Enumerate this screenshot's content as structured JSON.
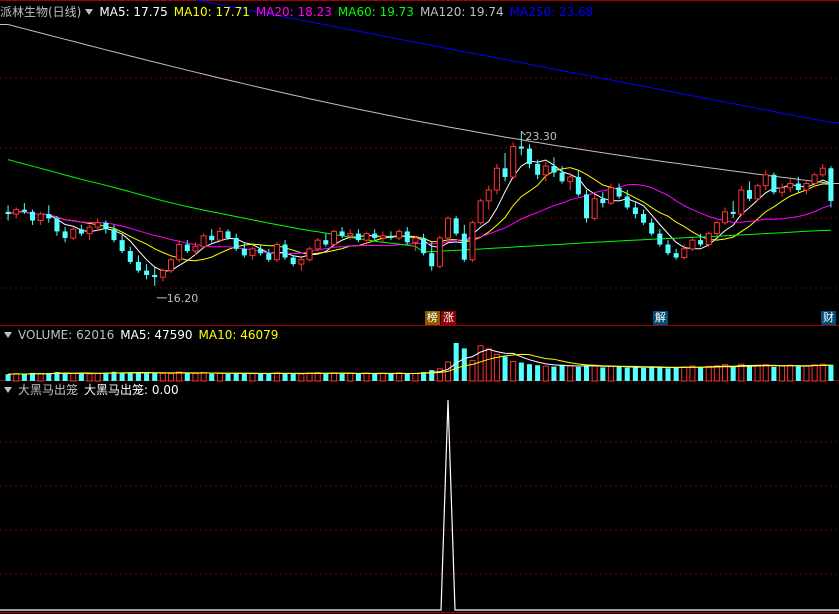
{
  "header": {
    "stock_name": "派林生物(日线)",
    "ma": [
      {
        "label": "MA5: 17.75",
        "color": "#ffffff"
      },
      {
        "label": "MA10: 17.71",
        "color": "#ffff00"
      },
      {
        "label": "MA20: 18.23",
        "color": "#ff00ff"
      },
      {
        "label": "MA60: 19.73",
        "color": "#00ff00"
      },
      {
        "label": "MA120: 19.74",
        "color": "#c0c0c0"
      },
      {
        "label": "MA250: 23.68",
        "color": "#0000ff"
      }
    ]
  },
  "volume_header": {
    "volume": "VOLUME: 62016",
    "ma5": "MA5: 47590",
    "ma10": "MA10: 46079"
  },
  "indicator_header": {
    "name": "大黑马出笼",
    "series": "大黑马出笼: 0.00"
  },
  "annotations": {
    "high": "23.30",
    "low": "16.20",
    "tags": [
      {
        "text": "榜",
        "bg": "#8b5a00"
      },
      {
        "text": "涨",
        "bg": "#8b0000"
      },
      {
        "text": "解",
        "bg": "#004f7a"
      },
      {
        "text": "财",
        "bg": "#004f7a"
      }
    ]
  },
  "chart_data": {
    "type": "candlestick",
    "price_range": [
      15.0,
      28.5
    ],
    "candles": [
      [
        19.6,
        19.9,
        19.2,
        19.5
      ],
      [
        19.5,
        19.8,
        19.3,
        19.7
      ],
      [
        19.7,
        20.0,
        19.5,
        19.6
      ],
      [
        19.6,
        19.7,
        19.0,
        19.2
      ],
      [
        19.2,
        19.6,
        19.0,
        19.5
      ],
      [
        19.5,
        19.9,
        19.1,
        19.3
      ],
      [
        19.3,
        19.4,
        18.5,
        18.7
      ],
      [
        18.7,
        18.9,
        18.2,
        18.4
      ],
      [
        18.4,
        18.9,
        18.3,
        18.8
      ],
      [
        18.8,
        19.0,
        18.5,
        18.6
      ],
      [
        18.6,
        19.0,
        18.3,
        18.9
      ],
      [
        18.9,
        19.3,
        18.7,
        19.1
      ],
      [
        19.1,
        19.2,
        18.6,
        18.8
      ],
      [
        18.8,
        19.0,
        18.2,
        18.3
      ],
      [
        18.3,
        18.6,
        17.7,
        17.8
      ],
      [
        17.8,
        18.0,
        17.2,
        17.3
      ],
      [
        17.3,
        17.6,
        16.8,
        16.9
      ],
      [
        16.9,
        17.2,
        16.5,
        16.7
      ],
      [
        16.7,
        17.1,
        16.2,
        16.6
      ],
      [
        16.6,
        17.0,
        16.4,
        16.9
      ],
      [
        16.9,
        17.5,
        16.8,
        17.4
      ],
      [
        17.4,
        18.3,
        17.3,
        18.1
      ],
      [
        18.1,
        18.3,
        17.7,
        17.8
      ],
      [
        17.8,
        18.2,
        17.6,
        18.0
      ],
      [
        18.0,
        18.6,
        17.9,
        18.5
      ],
      [
        18.5,
        18.8,
        18.2,
        18.3
      ],
      [
        18.3,
        18.9,
        18.2,
        18.7
      ],
      [
        18.7,
        18.8,
        18.3,
        18.4
      ],
      [
        18.4,
        18.6,
        17.8,
        17.9
      ],
      [
        17.9,
        18.2,
        17.5,
        17.6
      ],
      [
        17.6,
        18.0,
        17.4,
        17.9
      ],
      [
        17.9,
        18.1,
        17.6,
        17.7
      ],
      [
        17.7,
        17.9,
        17.3,
        17.4
      ],
      [
        17.4,
        18.2,
        17.3,
        18.1
      ],
      [
        18.1,
        18.3,
        17.4,
        17.5
      ],
      [
        17.5,
        17.6,
        17.1,
        17.2
      ],
      [
        17.2,
        17.5,
        16.9,
        17.4
      ],
      [
        17.4,
        18.0,
        17.3,
        17.9
      ],
      [
        17.9,
        18.4,
        17.8,
        18.3
      ],
      [
        18.3,
        18.6,
        18.0,
        18.1
      ],
      [
        18.1,
        18.8,
        18.0,
        18.7
      ],
      [
        18.7,
        18.9,
        18.4,
        18.5
      ],
      [
        18.5,
        18.8,
        18.3,
        18.6
      ],
      [
        18.6,
        18.8,
        18.2,
        18.3
      ],
      [
        18.3,
        18.7,
        18.1,
        18.6
      ],
      [
        18.6,
        18.8,
        18.3,
        18.4
      ],
      [
        18.4,
        18.7,
        18.2,
        18.5
      ],
      [
        18.5,
        18.7,
        18.3,
        18.4
      ],
      [
        18.4,
        18.8,
        18.3,
        18.7
      ],
      [
        18.7,
        18.9,
        18.1,
        18.2
      ],
      [
        18.2,
        18.5,
        17.8,
        18.4
      ],
      [
        18.4,
        18.6,
        17.6,
        17.7
      ],
      [
        17.7,
        18.2,
        16.9,
        17.1
      ],
      [
        17.1,
        18.5,
        17.0,
        18.4
      ],
      [
        18.4,
        19.4,
        18.3,
        19.3
      ],
      [
        19.3,
        19.4,
        18.5,
        18.6
      ],
      [
        18.6,
        19.0,
        17.3,
        17.4
      ],
      [
        17.4,
        19.2,
        17.3,
        19.1
      ],
      [
        19.1,
        20.2,
        19.0,
        20.1
      ],
      [
        20.1,
        20.8,
        19.7,
        20.6
      ],
      [
        20.6,
        21.8,
        20.4,
        21.6
      ],
      [
        21.6,
        22.3,
        21.0,
        21.2
      ],
      [
        21.2,
        22.8,
        21.1,
        22.6
      ],
      [
        22.6,
        23.3,
        22.2,
        22.5
      ],
      [
        22.5,
        22.7,
        21.6,
        21.8
      ],
      [
        21.8,
        22.0,
        21.1,
        21.3
      ],
      [
        21.3,
        21.9,
        21.0,
        21.7
      ],
      [
        21.7,
        22.1,
        21.2,
        21.4
      ],
      [
        21.4,
        21.7,
        20.9,
        21.0
      ],
      [
        21.0,
        21.4,
        20.6,
        21.2
      ],
      [
        21.2,
        21.5,
        20.3,
        20.4
      ],
      [
        20.4,
        20.6,
        19.1,
        19.3
      ],
      [
        19.3,
        20.4,
        19.2,
        20.2
      ],
      [
        20.2,
        20.5,
        19.8,
        20.0
      ],
      [
        20.0,
        20.9,
        19.9,
        20.7
      ],
      [
        20.7,
        20.9,
        20.2,
        20.3
      ],
      [
        20.3,
        20.6,
        19.7,
        19.8
      ],
      [
        19.8,
        20.1,
        19.3,
        19.5
      ],
      [
        19.5,
        19.7,
        19.0,
        19.1
      ],
      [
        19.1,
        19.3,
        18.5,
        18.6
      ],
      [
        18.6,
        18.8,
        18.0,
        18.1
      ],
      [
        18.1,
        18.3,
        17.6,
        17.7
      ],
      [
        17.7,
        17.9,
        17.4,
        17.5
      ],
      [
        17.5,
        18.1,
        17.4,
        17.9
      ],
      [
        17.9,
        18.4,
        17.8,
        18.3
      ],
      [
        18.3,
        18.6,
        18.0,
        18.1
      ],
      [
        18.1,
        18.7,
        18.0,
        18.6
      ],
      [
        18.6,
        19.2,
        18.5,
        19.1
      ],
      [
        19.1,
        19.8,
        19.0,
        19.6
      ],
      [
        19.6,
        20.1,
        19.3,
        19.5
      ],
      [
        19.5,
        20.8,
        19.4,
        20.6
      ],
      [
        20.6,
        21.0,
        20.1,
        20.2
      ],
      [
        20.2,
        20.9,
        20.1,
        20.8
      ],
      [
        20.8,
        21.5,
        20.6,
        21.3
      ],
      [
        21.3,
        21.4,
        20.4,
        20.5
      ],
      [
        20.5,
        20.9,
        20.3,
        20.7
      ],
      [
        20.7,
        21.1,
        20.5,
        20.9
      ],
      [
        20.9,
        21.2,
        20.5,
        20.6
      ],
      [
        20.6,
        21.0,
        20.4,
        20.9
      ],
      [
        20.9,
        21.4,
        20.8,
        21.3
      ],
      [
        21.3,
        21.8,
        21.2,
        21.6
      ],
      [
        21.6,
        21.7,
        19.8,
        20.1
      ]
    ],
    "ma_series": [
      {
        "name": "MA5",
        "color": "#ffffff"
      },
      {
        "name": "MA10",
        "color": "#ffff00"
      },
      {
        "name": "MA20",
        "color": "#ff00ff"
      },
      {
        "name": "MA60",
        "color": "#00ff00"
      },
      {
        "name": "MA120",
        "color": "#c0c0c0",
        "start": 28.2,
        "end": 20.9
      },
      {
        "name": "MA250",
        "color": "#0000ff",
        "start": 31.0,
        "end": 23.7
      }
    ],
    "volume": [
      25,
      27,
      24,
      30,
      26,
      28,
      33,
      30,
      27,
      29,
      26,
      28,
      31,
      34,
      30,
      29,
      32,
      31,
      30,
      28,
      27,
      33,
      29,
      28,
      31,
      27,
      29,
      26,
      30,
      28,
      27,
      26,
      28,
      30,
      29,
      27,
      26,
      29,
      31,
      28,
      30,
      27,
      28,
      26,
      29,
      27,
      28,
      26,
      30,
      27,
      28,
      33,
      40,
      45,
      70,
      140,
      120,
      75,
      130,
      118,
      98,
      90,
      72,
      68,
      62,
      58,
      55,
      53,
      60,
      56,
      52,
      58,
      55,
      50,
      54,
      52,
      49,
      51,
      48,
      53,
      50,
      47,
      49,
      52,
      55,
      50,
      54,
      56,
      60,
      52,
      62,
      55,
      58,
      60,
      52,
      55,
      58,
      54,
      56,
      60,
      62,
      60
    ],
    "volume_ma5_end": 47590,
    "volume_ma10_end": 46079,
    "indicator": {
      "peak_index": 54,
      "peak_value": 1.0,
      "current": 0.0
    }
  }
}
